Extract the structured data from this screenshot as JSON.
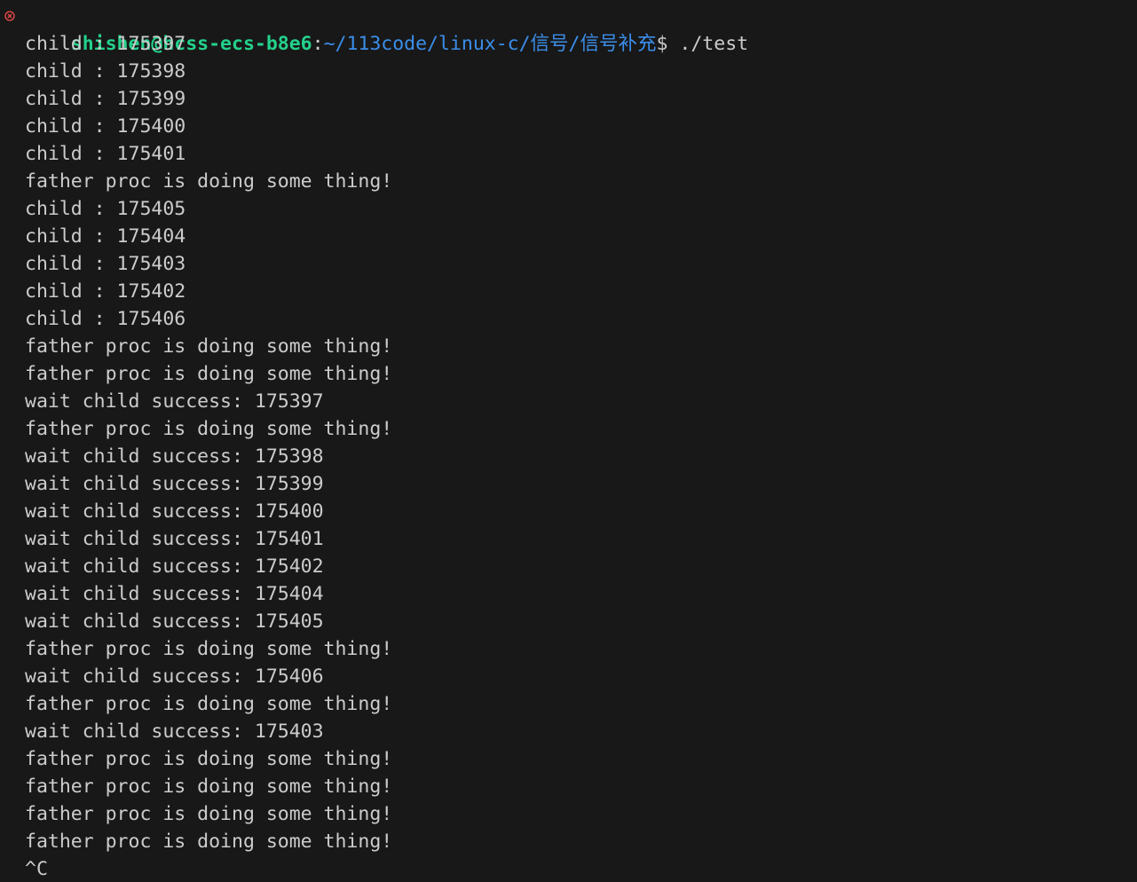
{
  "prompt": {
    "user_host": "shishen@hcss-ecs-b8e6",
    "colon": ":",
    "path": "~/113code/linux-c/信号/信号补充",
    "dollar": "$",
    "command": " ./test",
    "status_icon": "error-circle-x-icon",
    "status_color": "#f14c4c"
  },
  "colors": {
    "background": "#181818",
    "text": "#cccccc",
    "user_host": "#23d18b",
    "path": "#3b8eea"
  },
  "output_lines": [
    "child : 175397",
    "child : 175398",
    "child : 175399",
    "child : 175400",
    "child : 175401",
    "father proc is doing some thing!",
    "child : 175405",
    "child : 175404",
    "child : 175403",
    "child : 175402",
    "child : 175406",
    "father proc is doing some thing!",
    "father proc is doing some thing!",
    "wait child success: 175397",
    "father proc is doing some thing!",
    "wait child success: 175398",
    "wait child success: 175399",
    "wait child success: 175400",
    "wait child success: 175401",
    "wait child success: 175402",
    "wait child success: 175404",
    "wait child success: 175405",
    "father proc is doing some thing!",
    "wait child success: 175406",
    "father proc is doing some thing!",
    "wait child success: 175403",
    "father proc is doing some thing!",
    "father proc is doing some thing!",
    "father proc is doing some thing!",
    "father proc is doing some thing!",
    "^C"
  ]
}
